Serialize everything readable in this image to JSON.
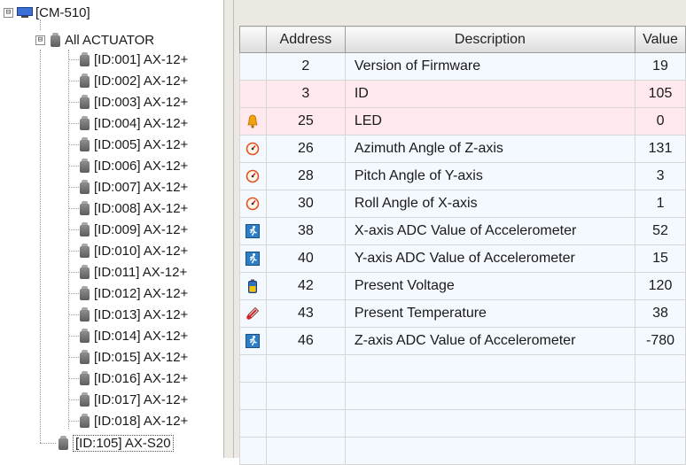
{
  "tree": {
    "root": {
      "label": "[CM-510]",
      "expander": "⊟"
    },
    "group": {
      "label": "All ACTUATOR",
      "expander": "⊟"
    },
    "actuators": [
      "[ID:001] AX-12+",
      "[ID:002] AX-12+",
      "[ID:003] AX-12+",
      "[ID:004] AX-12+",
      "[ID:005] AX-12+",
      "[ID:006] AX-12+",
      "[ID:007] AX-12+",
      "[ID:008] AX-12+",
      "[ID:009] AX-12+",
      "[ID:010] AX-12+",
      "[ID:011] AX-12+",
      "[ID:012] AX-12+",
      "[ID:013] AX-12+",
      "[ID:014] AX-12+",
      "[ID:015] AX-12+",
      "[ID:016] AX-12+",
      "[ID:017] AX-12+",
      "[ID:018] AX-12+"
    ],
    "sensor": {
      "label": "[ID:105] AX-S20"
    }
  },
  "table": {
    "headers": {
      "icon": "",
      "address": "Address",
      "description": "Description",
      "value": "Value"
    },
    "rows": [
      {
        "icon": "none",
        "address": "2",
        "description": "Version of Firmware",
        "value": "19",
        "highlight": false
      },
      {
        "icon": "none",
        "address": "3",
        "description": "ID",
        "value": "105",
        "highlight": true
      },
      {
        "icon": "bell-icon",
        "address": "25",
        "description": "LED",
        "value": "0",
        "highlight": true
      },
      {
        "icon": "gauge-icon",
        "address": "26",
        "description": "Azimuth Angle of Z-axis",
        "value": "131",
        "highlight": false
      },
      {
        "icon": "gauge-icon",
        "address": "28",
        "description": "Pitch Angle of Y-axis",
        "value": "3",
        "highlight": false
      },
      {
        "icon": "gauge-icon",
        "address": "30",
        "description": "Roll Angle of X-axis",
        "value": "1",
        "highlight": false
      },
      {
        "icon": "runner-icon",
        "address": "38",
        "description": "X-axis ADC Value of Accelerometer",
        "value": "52",
        "highlight": false
      },
      {
        "icon": "runner-icon",
        "address": "40",
        "description": "Y-axis ADC Value of Accelerometer",
        "value": "15",
        "highlight": false
      },
      {
        "icon": "battery-icon",
        "address": "42",
        "description": "Present Voltage",
        "value": "120",
        "highlight": false
      },
      {
        "icon": "thermometer-icon",
        "address": "43",
        "description": "Present Temperature",
        "value": "38",
        "highlight": false
      },
      {
        "icon": "runner-icon",
        "address": "46",
        "description": "Z-axis ADC Value of Accelerometer",
        "value": "-780",
        "highlight": false
      }
    ]
  },
  "colors": {
    "highlight_row": "#ffe9ee",
    "normal_row": "#f4f8ff",
    "panel_bg": "#ece9e2"
  }
}
